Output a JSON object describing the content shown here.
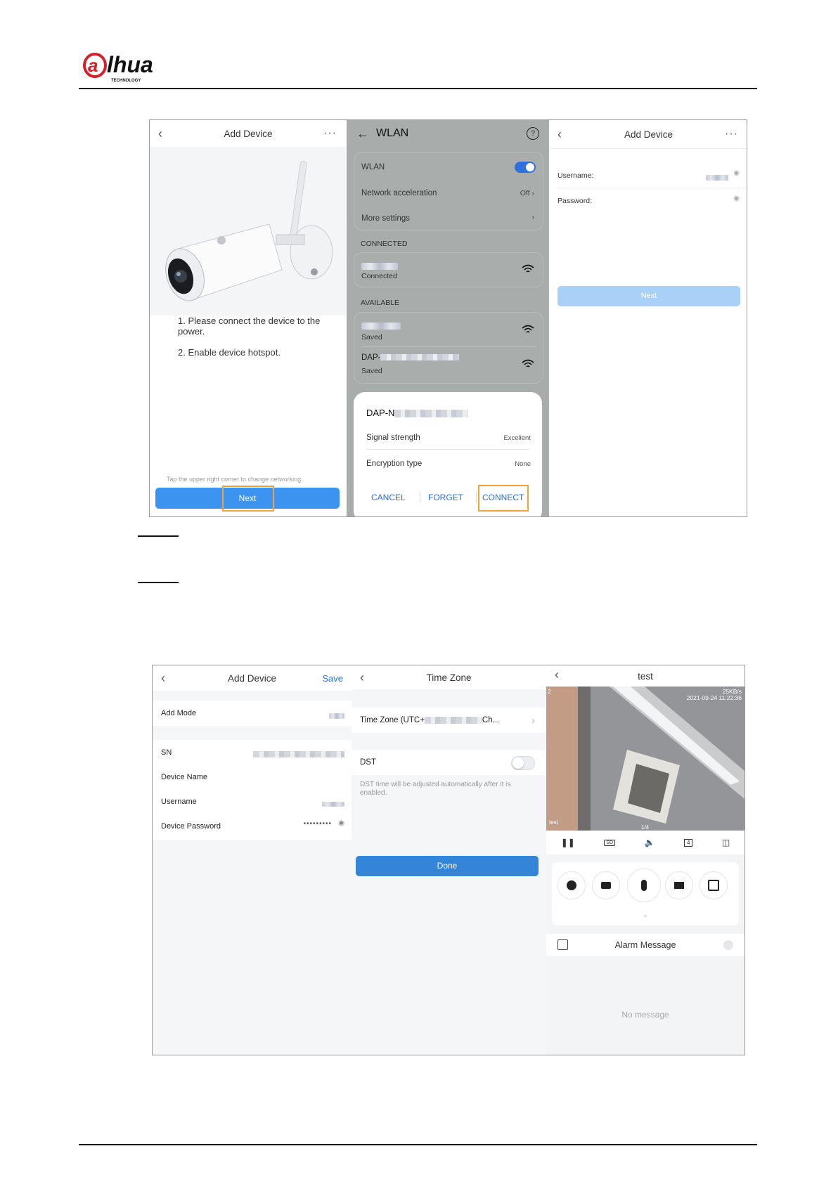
{
  "header": {
    "brand_sub": "TECHNOLOGY"
  },
  "fig1": {
    "s1": {
      "title": "Add Device",
      "step1": "1. Please connect the device to the power.",
      "step2": "2. Enable device hotspot.",
      "hint": "Tap the upper right corner to change networking.",
      "next": "Next"
    },
    "s2": {
      "title": "WLAN",
      "wlan": "WLAN",
      "accel": "Network acceleration",
      "accel_val": "Off",
      "more": "More settings",
      "connected_hdr": "CONNECTED",
      "connected": "Connected",
      "available_hdr": "AVAILABLE",
      "saved": "Saved",
      "dap": "DAP-",
      "dap_n": "DAP-N",
      "signal": "Signal strength",
      "signal_val": "Excellent",
      "enc": "Encryption type",
      "enc_val": "None",
      "cancel": "CANCEL",
      "forget": "FORGET",
      "connect": "CONNECT"
    },
    "s3": {
      "title": "Add Device",
      "username": "Username:",
      "password": "Password:",
      "next": "Next"
    }
  },
  "fig2": {
    "s1": {
      "title": "Add Device",
      "save": "Save",
      "add_mode": "Add Mode",
      "sn": "SN",
      "device_name": "Device Name",
      "username": "Username",
      "device_password": "Device Password",
      "password_dots": "•••••••••"
    },
    "s2": {
      "title": "Time Zone",
      "tz_prefix": "Time Zone  (UTC+",
      "tz_suffix": "Ch...",
      "dst": "DST",
      "dst_note": "DST time will be adjusted automatically after it is enabled.",
      "done": "Done"
    },
    "s3": {
      "title": "test",
      "speed": "25KB/s",
      "timestamp": "2021-09-24 11:22:36",
      "channel": "2",
      "cam_name": "test",
      "page": "1/4",
      "alarm": "Alarm Message",
      "no_message": "No message"
    }
  }
}
